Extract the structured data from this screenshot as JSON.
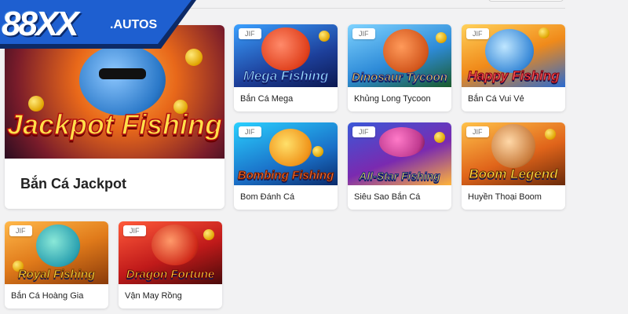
{
  "brand": {
    "logo_main": "88XX",
    "logo_suffix": ".AUTOS"
  },
  "badge_text": "JIF",
  "colors": {
    "page_bg": "#f2f2f3",
    "card_bg": "#ffffff",
    "logo_blue": "#1e5fd0"
  },
  "featured": {
    "thumb_title": "Jackpot Fishing",
    "label": "Bắn Cá Jackpot"
  },
  "games": [
    {
      "thumb_title": "Mega Fishing",
      "label": "Bắn Cá Mega"
    },
    {
      "thumb_title": "Dinosaur Tycoon",
      "label": "Khủng Long Tycoon"
    },
    {
      "thumb_title": "Happy Fishing",
      "label": "Bắn Cá Vui Vẻ"
    },
    {
      "thumb_title": "Bombing Fishing",
      "label": "Bom Đánh Cá"
    },
    {
      "thumb_title": "All-Star Fishing",
      "label": "Siêu Sao Bắn Cá"
    },
    {
      "thumb_title": "Boom Legend",
      "label": "Huyền Thoại Boom"
    },
    {
      "thumb_title": "Royal Fishing",
      "label": "Bắn Cá Hoàng Gia"
    },
    {
      "thumb_title": "Dragon Fortune",
      "label": "Vận May Rồng"
    }
  ]
}
